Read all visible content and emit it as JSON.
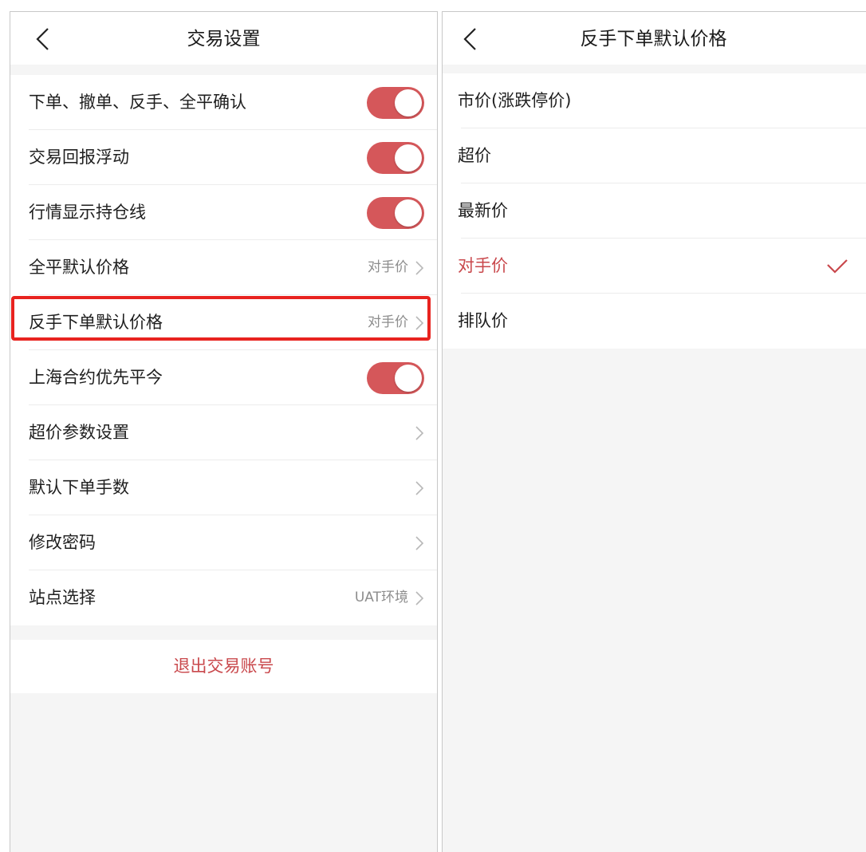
{
  "left": {
    "title": "交易设置",
    "rows": [
      {
        "label": "下单、撤单、反手、全平确认",
        "type": "toggle",
        "on": true
      },
      {
        "label": "交易回报浮动",
        "type": "toggle",
        "on": true
      },
      {
        "label": "行情显示持仓线",
        "type": "toggle",
        "on": true
      },
      {
        "label": "全平默认价格",
        "type": "value",
        "value": "对手价"
      },
      {
        "label": "反手下单默认价格",
        "type": "value",
        "value": "对手价",
        "highlighted": true
      },
      {
        "label": "上海合约优先平今",
        "type": "toggle",
        "on": true
      },
      {
        "label": "超价参数设置",
        "type": "link"
      },
      {
        "label": "默认下单手数",
        "type": "link"
      },
      {
        "label": "修改密码",
        "type": "link"
      },
      {
        "label": "站点选择",
        "type": "value",
        "value": "UAT环境"
      }
    ],
    "logout_label": "退出交易账号"
  },
  "right": {
    "title": "反手下单默认价格",
    "options": [
      {
        "label": "市价(涨跌停价)",
        "selected": false
      },
      {
        "label": "超价",
        "selected": false
      },
      {
        "label": "最新价",
        "selected": false
      },
      {
        "label": "对手价",
        "selected": true
      },
      {
        "label": "排队价",
        "selected": false
      }
    ]
  },
  "icons": {
    "back": "chevron-left-icon",
    "disclosure": "chevron-right-icon",
    "selected": "checkmark-icon"
  },
  "colors": {
    "accent": "#c9484c",
    "toggle_on": "#d5575a",
    "highlight_border": "#e8231f",
    "background": "#f5f5f5"
  }
}
